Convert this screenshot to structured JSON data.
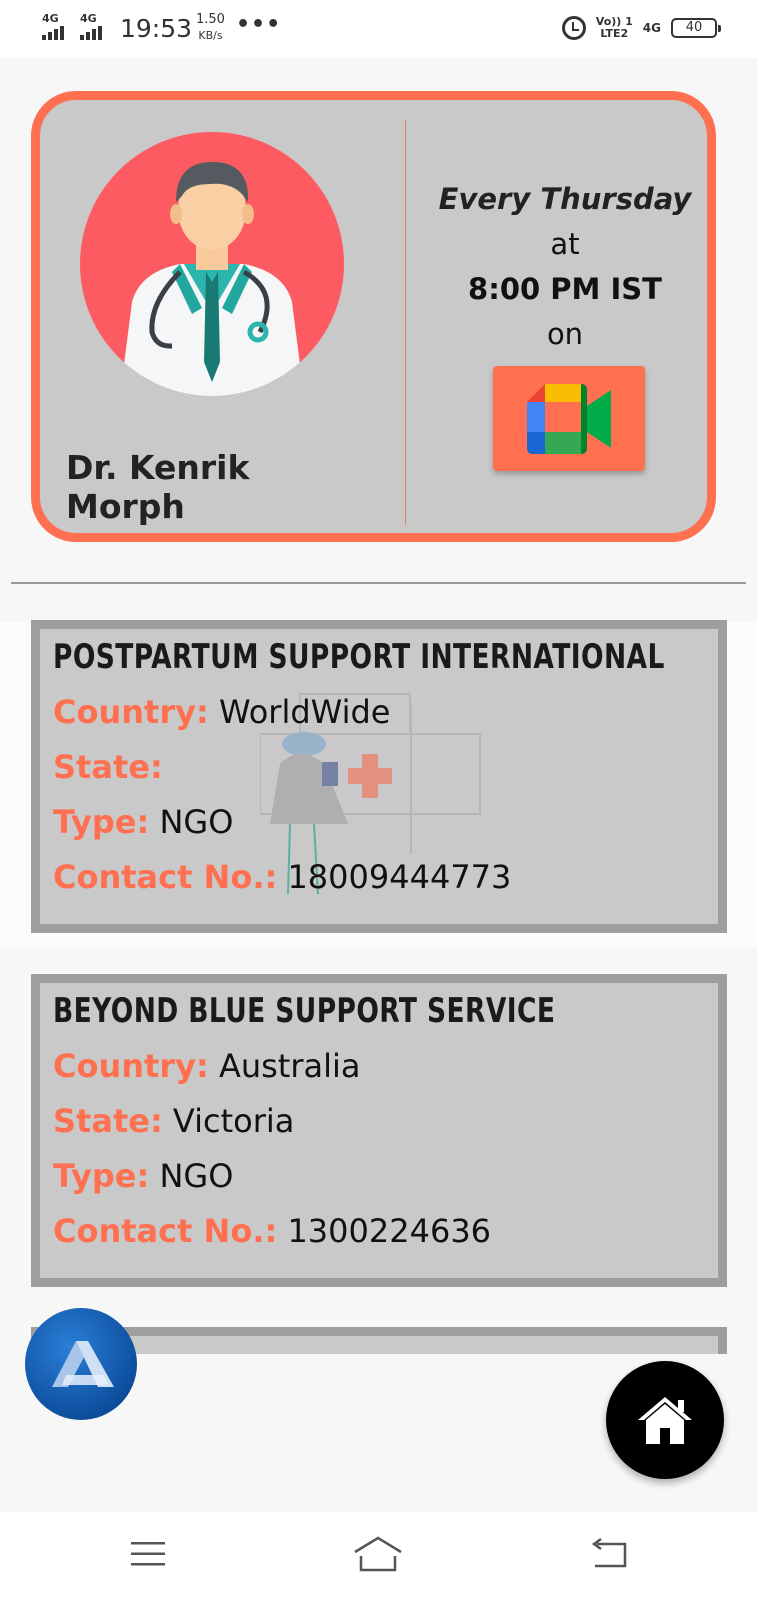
{
  "status_bar": {
    "net1": "4G",
    "net2": "4G",
    "time": "19:53",
    "speed_value": "1.50",
    "speed_unit": "KB/s",
    "dots": "•••",
    "lte_top": "Vo)) 1",
    "lte_bottom": "LTE2",
    "net3": "4G",
    "battery": "40"
  },
  "doctor": {
    "name": "Dr. Kenrik Morph",
    "day": "Every Thursday",
    "at": "at",
    "time": "8:00 PM IST",
    "on": "on",
    "meet_icon": "google-meet-icon"
  },
  "orgs": [
    {
      "title": "POSTPARTUM SUPPORT INTERNATIONAL",
      "country_label": "Country:",
      "country": "WorldWide",
      "state_label": "State:",
      "state": "",
      "type_label": "Type:",
      "type": "NGO",
      "contact_label": "Contact No.:",
      "contact": "18009444773"
    },
    {
      "title": "BEYOND BLUE SUPPORT SERVICE",
      "country_label": "Country:",
      "country": "Australia",
      "state_label": "State:",
      "state": "Victoria",
      "type_label": "Type:",
      "type": "NGO",
      "contact_label": "Contact No.:",
      "contact": "1300224636"
    }
  ],
  "floating": {
    "logo_icon": "app-logo-icon",
    "home_icon": "home-icon"
  },
  "nav": {
    "menu_icon": "menu-icon",
    "home_icon": "home-outline-icon",
    "back_icon": "back-icon"
  },
  "colors": {
    "accent": "#ff7050",
    "card_bg": "#c9c9c9",
    "avatar_bg": "#fd5b62",
    "org_border": "#9e9e9e"
  }
}
